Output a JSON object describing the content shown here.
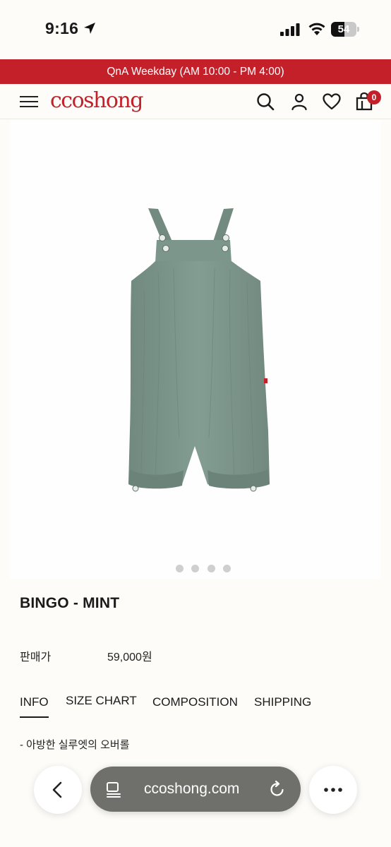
{
  "status_bar": {
    "time": "9:16",
    "battery": "54",
    "battery_level": 0.54
  },
  "notice": {
    "text": "QnA Weekday (AM 10:00 - PM 4:00)"
  },
  "header": {
    "logo": "ccoshong",
    "cart_count": "0",
    "icons": [
      "menu-icon",
      "search-icon",
      "account-icon",
      "heart-icon",
      "cart-icon"
    ]
  },
  "product": {
    "image_description_icon": "overalls-image",
    "image_color": "#7e9a90",
    "carousel_count": 4,
    "name": "BINGO - MINT",
    "price_label": "판매가",
    "price": "59,000원",
    "description": "- 아방한 실루엣의 오버롤"
  },
  "tabs": [
    {
      "label": "INFO",
      "active": true
    },
    {
      "label": "SIZE CHART",
      "active": false
    },
    {
      "label": "COMPOSITION",
      "active": false
    },
    {
      "label": "SHIPPING",
      "active": false
    }
  ],
  "browser": {
    "url": "ccoshong.com"
  },
  "colors": {
    "brand_red": "#c4202a",
    "background": "#fdfcf9"
  }
}
